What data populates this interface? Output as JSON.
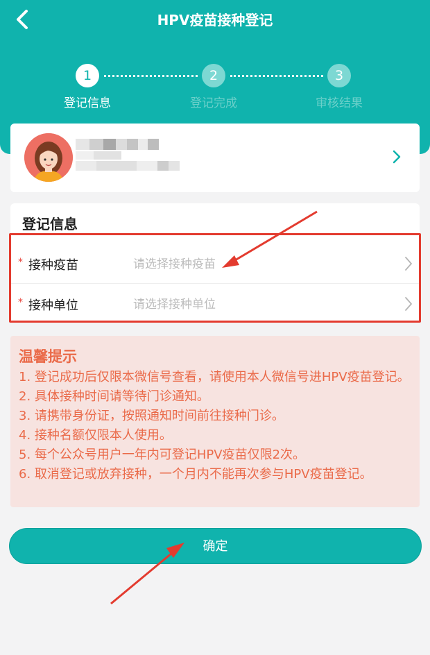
{
  "header": {
    "title": "HPV疫苗接种登记"
  },
  "steps": [
    {
      "number": "1",
      "label": "登记信息"
    },
    {
      "number": "2",
      "label": "登记完成"
    },
    {
      "number": "3",
      "label": "审核结果"
    }
  ],
  "form": {
    "title": "登记信息",
    "rows": [
      {
        "required": "*",
        "label": "接种疫苗",
        "placeholder": "请选择接种疫苗"
      },
      {
        "required": "*",
        "label": "接种单位",
        "placeholder": "请选择接种单位"
      }
    ]
  },
  "tips": {
    "title": "温馨提示",
    "items": [
      "1. 登记成功后仅限本微信号查看，请使用本人微信号进HPV疫苗登记。",
      "2. 具体接种时间请等待门诊通知。",
      "3. 请携带身份证，按照通知时间前往接种门诊。",
      "4. 接种名额仅限本人使用。",
      "5. 每个公众号用户一年内可登记HPV疫苗仅限2次。",
      "6. 取消登记或放弃接种，一个月内不能再次参与HPV疫苗登记。"
    ]
  },
  "confirm_button": "确定",
  "colors": {
    "primary": "#10b3ad",
    "tips_text": "#ea6a49",
    "annotation_red": "#e33b2f"
  },
  "icons": {
    "back": "chevron-left-icon",
    "card_arrow": "chevron-right-icon",
    "row_arrow": "chevron-right-icon",
    "avatar": "avatar-icon"
  }
}
